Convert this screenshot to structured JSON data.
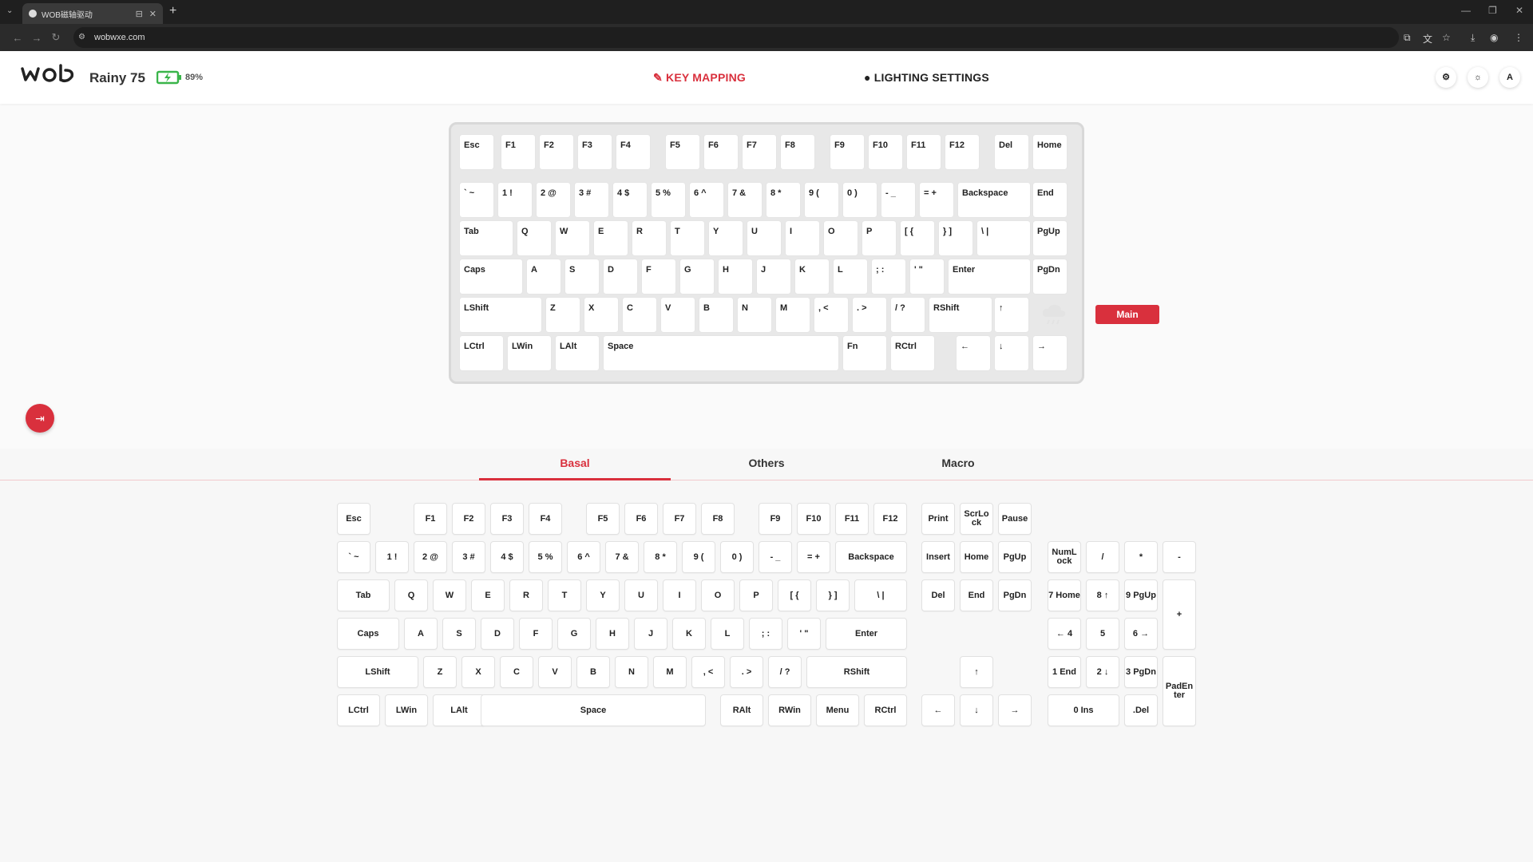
{
  "browser": {
    "tab_title": "WOB磁轴驱动",
    "url": "wobwxe.com"
  },
  "header": {
    "keyboard_name": "Rainy 75",
    "battery": "89%",
    "nav_key_mapping": "KEY MAPPING",
    "nav_lighting": "LIGHTING SETTINGS",
    "user_initial": "A"
  },
  "keyboard": {
    "rows": [
      [
        "Esc",
        "F1",
        "F2",
        "F3",
        "F4",
        "F5",
        "F6",
        "F7",
        "F8",
        "F9",
        "F10",
        "F11",
        "F12",
        "Del",
        "Home"
      ],
      [
        "` ~",
        "1 !",
        "2 @",
        "3 #",
        "4 $",
        "5 %",
        "6 ^",
        "7 &",
        "8 *",
        "9 (",
        "0 )",
        "- _",
        "= +",
        "Backspace",
        "End"
      ],
      [
        "Tab",
        "Q",
        "W",
        "E",
        "R",
        "T",
        "Y",
        "U",
        "I",
        "O",
        "P",
        "[ {",
        "} ]",
        "\\ |",
        "PgUp"
      ],
      [
        "Caps",
        "A",
        "S",
        "D",
        "F",
        "G",
        "H",
        "J",
        "K",
        "L",
        ";  :",
        "' \"",
        "Enter",
        "PgDn"
      ],
      [
        "LShift",
        "Z",
        "X",
        "C",
        "V",
        "B",
        "N",
        "M",
        ", <",
        ". >",
        "/ ?",
        "RShift",
        "↑"
      ],
      [
        "LCtrl",
        "LWin",
        "LAlt",
        "Space",
        "Fn",
        "RCtrl",
        "←",
        "↓",
        "→"
      ]
    ],
    "layer_button": "Main"
  },
  "lower_tabs": [
    "Basal",
    "Others",
    "Macro"
  ],
  "palette": {
    "main": [
      [
        "Esc",
        "F1",
        "F2",
        "F3",
        "F4",
        "F5",
        "F6",
        "F7",
        "F8",
        "F9",
        "F10",
        "F11",
        "F12"
      ],
      [
        "` ~",
        "1 !",
        "2 @",
        "3 #",
        "4 $",
        "5 %",
        "6 ^",
        "7 &",
        "8 *",
        "9 (",
        "0 )",
        "- _",
        "= +",
        "Backspace"
      ],
      [
        "Tab",
        "Q",
        "W",
        "E",
        "R",
        "T",
        "Y",
        "U",
        "I",
        "O",
        "P",
        "[ {",
        "} ]",
        "\\ |"
      ],
      [
        "Caps",
        "A",
        "S",
        "D",
        "F",
        "G",
        "H",
        "J",
        "K",
        "L",
        "; :",
        "' \"",
        "Enter"
      ],
      [
        "LShift",
        "Z",
        "X",
        "C",
        "V",
        "B",
        "N",
        "M",
        ", <",
        ". >",
        "/ ?",
        "RShift"
      ],
      [
        "LCtrl",
        "LWin",
        "LAlt",
        "Space",
        "RAlt",
        "RWin",
        "Menu",
        "RCtrl"
      ]
    ],
    "nav": [
      [
        "Print",
        "ScrLo ck",
        "Pause"
      ],
      [
        "Insert",
        "Home",
        "PgUp"
      ],
      [
        "Del",
        "End",
        "PgDn"
      ],
      [
        "↑"
      ],
      [
        "←",
        "↓",
        "→"
      ]
    ],
    "numpad": [
      "NumL ock",
      "/",
      "*",
      "-",
      "7 Home",
      "8 ↑",
      "9 PgUp",
      "+",
      "← 4",
      "5",
      "6 →",
      "1 End",
      "2 ↓",
      "3 PgDn",
      "PadEn ter",
      "0 Ins",
      ".Del"
    ]
  },
  "colors": {
    "accent": "#d9303d",
    "battery": "#3ab54a"
  }
}
